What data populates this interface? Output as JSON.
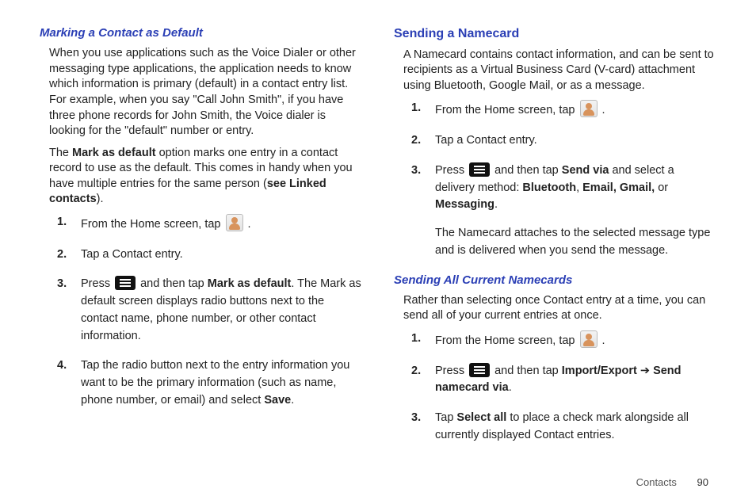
{
  "left": {
    "heading": "Marking a Contact as Default",
    "p1": "When you use applications such as the Voice Dialer or other messaging type applications, the application needs to know which information is primary (default) in a contact entry list. For example, when you say \"Call John Smith\", if you have three phone records for John Smith, the Voice dialer is looking for the \"default\" number or entry.",
    "p2a": "The ",
    "p2b": "Mark as default",
    "p2c": " option marks one entry in a contact record to use as the default. This comes in handy when you have multiple entries for the same person (",
    "p2d": "see Linked contacts",
    "p2e": ").",
    "s1a": "From the Home screen, tap ",
    "s1b": " .",
    "s2": "Tap a Contact entry.",
    "s3a": "Press ",
    "s3b": " and then tap ",
    "s3c": "Mark as default",
    "s3d": ". The Mark as default screen displays radio buttons next to the contact name, phone number, or other contact information.",
    "s4a": "Tap the radio button next to the entry information you want to be the primary information (such as name, phone number, or email) and select ",
    "s4b": "Save",
    "s4c": "."
  },
  "right": {
    "heading1": "Sending a Namecard",
    "p1": "A Namecard contains contact information, and can be sent to recipients as a Virtual Business Card (V-card) attachment using Bluetooth, Google Mail, or as a message.",
    "a1a": "From the Home screen, tap ",
    "a1b": " .",
    "a2": "Tap a Contact entry.",
    "a3a": "Press ",
    "a3b": " and then tap ",
    "a3c": "Send via",
    "a3d": " and select a delivery method: ",
    "a3e": "Bluetooth",
    "a3f": ", ",
    "a3g": "Email, Gmail,",
    "a3h": " or ",
    "a3i": "Messaging",
    "a3j": ".",
    "a_after": "The Namecard attaches to the selected message type and is delivered when you send the message.",
    "heading2": "Sending All Current Namecards",
    "p2": "Rather than selecting once Contact entry at a time, you can send all of your current entries at once.",
    "b1a": "From the Home screen, tap ",
    "b1b": " .",
    "b2a": "Press ",
    "b2b": " and then tap ",
    "b2c": "Import/Export",
    "b2d": " ➔ ",
    "b2e": "Send namecard via",
    "b2f": ".",
    "b3a": "Tap ",
    "b3b": "Select all",
    "b3c": " to place a check mark alongside all currently displayed Contact entries."
  },
  "footer": {
    "section": "Contacts",
    "page": "90"
  },
  "nums": {
    "n1": "1.",
    "n2": "2.",
    "n3": "3.",
    "n4": "4."
  }
}
